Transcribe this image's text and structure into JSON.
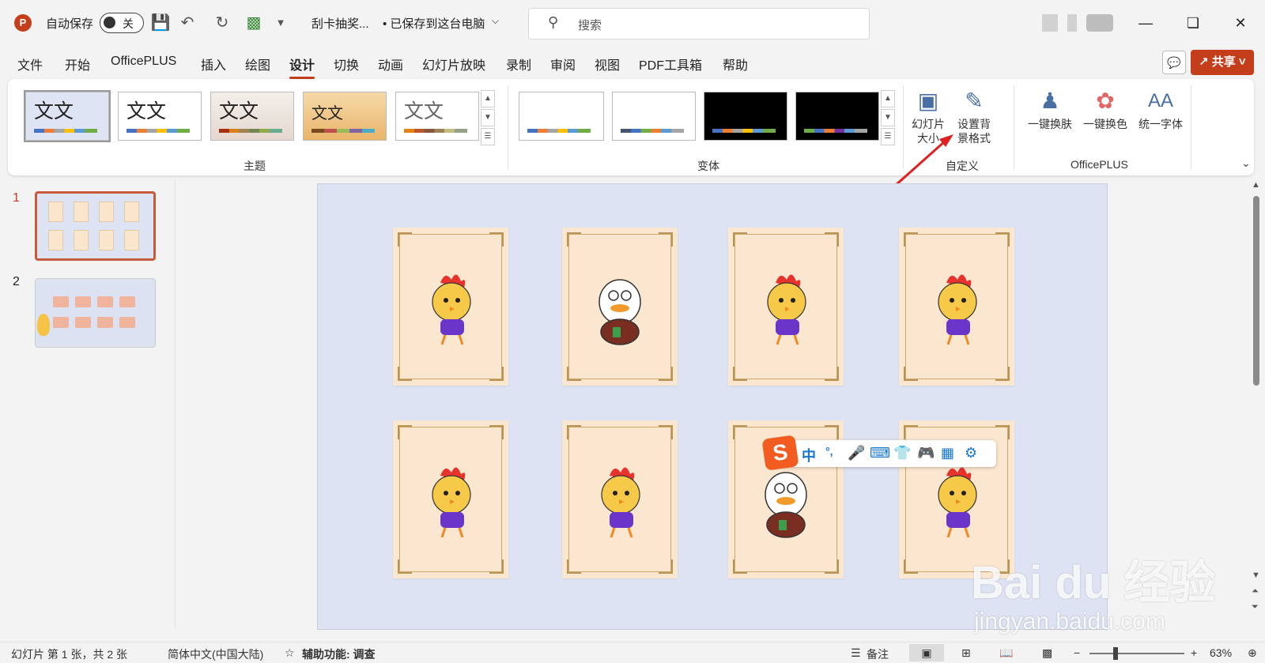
{
  "titlebar": {
    "app_icon": "powerpoint-icon",
    "autosave_label": "自动保存",
    "autosave_state": "关",
    "doc_name": "刮卡抽奖...",
    "save_status": "• 已保存到这台电脑",
    "search_placeholder": "搜索"
  },
  "menu": [
    "文件",
    "开始",
    "OfficePLUS",
    "插入",
    "绘图",
    "设计",
    "切换",
    "动画",
    "幻灯片放映",
    "录制",
    "审阅",
    "视图",
    "PDF工具箱",
    "帮助"
  ],
  "active_tab": "设计",
  "share_label": "共享",
  "ribbon": {
    "theme_text": "文文",
    "themes_label": "主题",
    "variants_label": "变体",
    "customize_label": "自定义",
    "officeplus_label": "OfficePLUS",
    "slide_size_label": "幻灯片大小",
    "format_bg_label": "设置背景格式",
    "one_click_skin": "一键换肤",
    "one_click_color": "一键换色",
    "unify_font": "统一字体"
  },
  "slides": [
    {
      "number": "1"
    },
    {
      "number": "2"
    }
  ],
  "ime": {
    "items": [
      "中",
      "°,",
      "mic-icon",
      "keyboard-icon",
      "shirt-icon",
      "game-icon",
      "apps-icon",
      "settings-icon"
    ]
  },
  "watermark": {
    "main": "Bai du 经验",
    "sub": "jingyan.baidu.com"
  },
  "status": {
    "slide_info": "幻灯片 第 1 张，共 2 张",
    "language": "简体中文(中国大陆)",
    "accessibility": "辅助功能: 调查",
    "notes": "备注",
    "zoom": "63%"
  },
  "colors": {
    "accent": "#c43e1c",
    "slide_bg": "#dee3f3",
    "card": "#fbe7cf"
  }
}
